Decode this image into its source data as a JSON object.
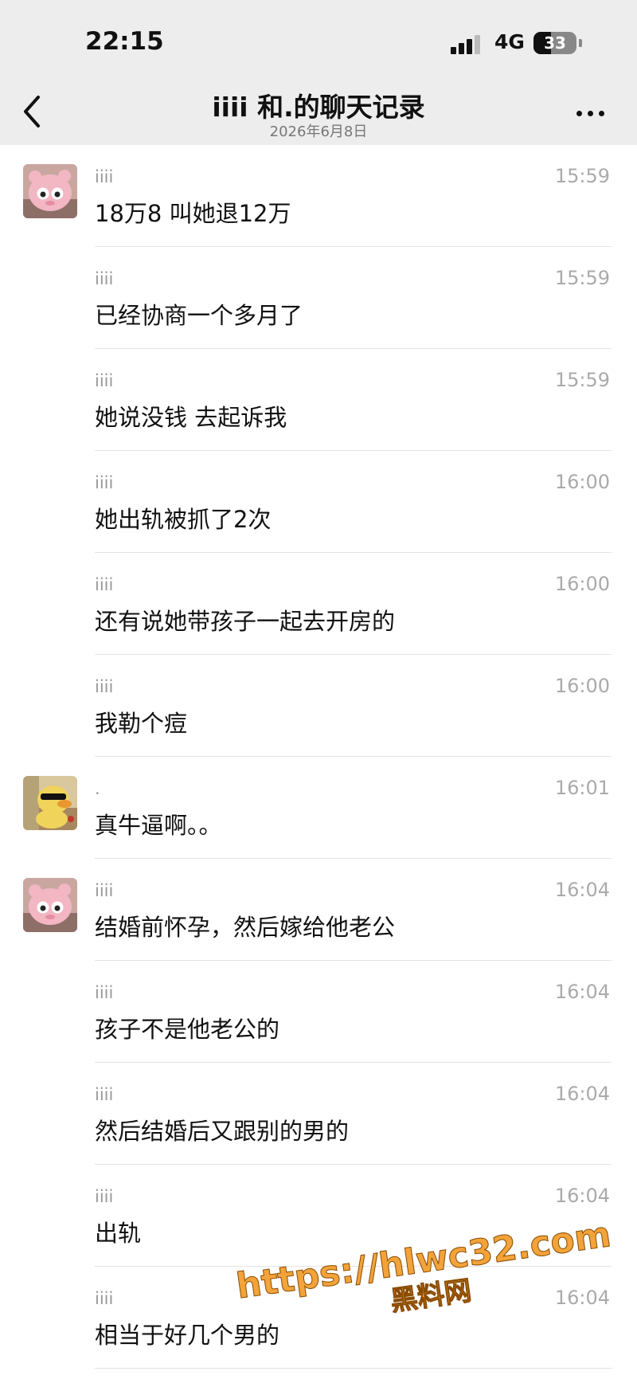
{
  "status_bar": {
    "time": "22:15",
    "network": "4G",
    "battery": "33"
  },
  "nav": {
    "title": "iiii 和.的聊天记录",
    "subtitle": "2026年6月8日"
  },
  "colors": {
    "background": "#ffffff",
    "header": "#ededed",
    "watermark": "#f2a33a"
  },
  "avatars": {
    "iiii": "pink-plush-toy",
    "dot": "sunglasses-duck"
  },
  "messages": [
    {
      "sender": "iiii",
      "time": "15:59",
      "text": "18万8 叫她退12万",
      "avatar": "iiii"
    },
    {
      "sender": "iiii",
      "time": "15:59",
      "text": "已经协商一个多月了"
    },
    {
      "sender": "iiii",
      "time": "15:59",
      "text": "她说没钱 去起诉我"
    },
    {
      "sender": "iiii",
      "time": "16:00",
      "text": "她出轨被抓了2次"
    },
    {
      "sender": "iiii",
      "time": "16:00",
      "text": "还有说她带孩子一起去开房的"
    },
    {
      "sender": "iiii",
      "time": "16:00",
      "text": "我勒个痘"
    },
    {
      "sender": ".",
      "time": "16:01",
      "text": "真牛逼啊。。",
      "avatar": "dot"
    },
    {
      "sender": "iiii",
      "time": "16:04",
      "text": "结婚前怀孕，然后嫁给他老公",
      "avatar": "iiii"
    },
    {
      "sender": "iiii",
      "time": "16:04",
      "text": "孩子不是他老公的"
    },
    {
      "sender": "iiii",
      "time": "16:04",
      "text": "然后结婚后又跟别的男的"
    },
    {
      "sender": "iiii",
      "time": "16:04",
      "text": "出轨"
    },
    {
      "sender": "iiii",
      "time": "16:04",
      "text": "相当于好几个男的"
    }
  ],
  "watermark": {
    "line1": "https://hlwc32.com",
    "line2": "黑料网"
  }
}
